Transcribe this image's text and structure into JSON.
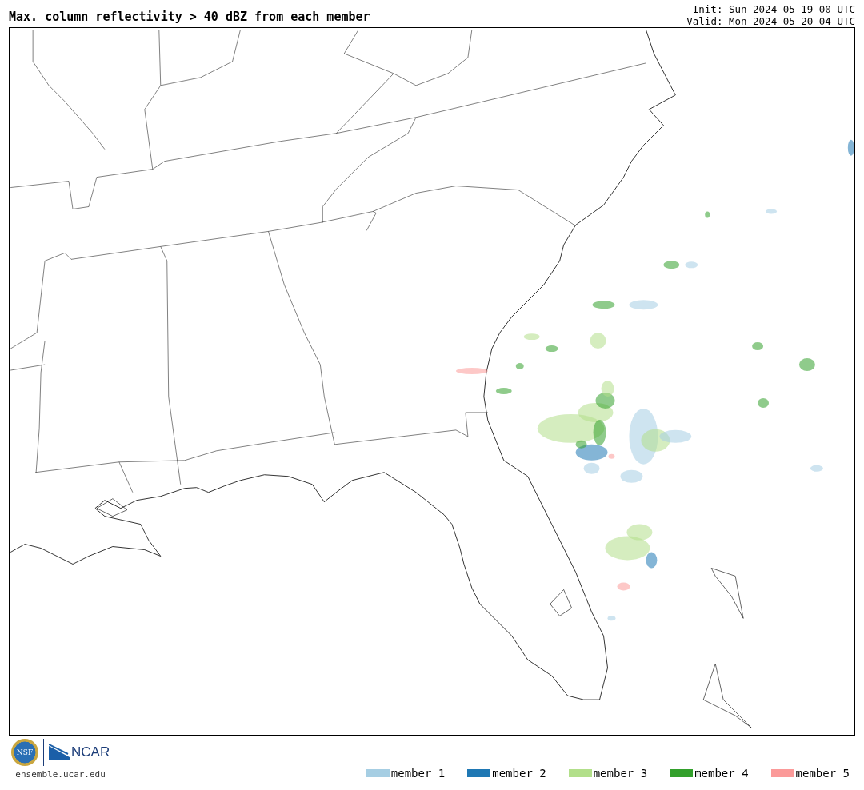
{
  "title": "Max. column reflectivity > 40 dBZ from each member",
  "init": "Init: Sun 2024-05-19 00 UTC",
  "valid": "Valid: Mon 2024-05-20 04 UTC",
  "logos": {
    "nsf": "NSF",
    "ncar": "NCAR"
  },
  "website": "ensemble.ucar.edu",
  "legend": [
    {
      "label": "member 1",
      "color": "#a6cee3"
    },
    {
      "label": "member 2",
      "color": "#1f78b4"
    },
    {
      "label": "member 3",
      "color": "#b2df8a"
    },
    {
      "label": "member 4",
      "color": "#33a02c"
    },
    {
      "label": "member 5",
      "color": "#fb9a99"
    }
  ]
}
